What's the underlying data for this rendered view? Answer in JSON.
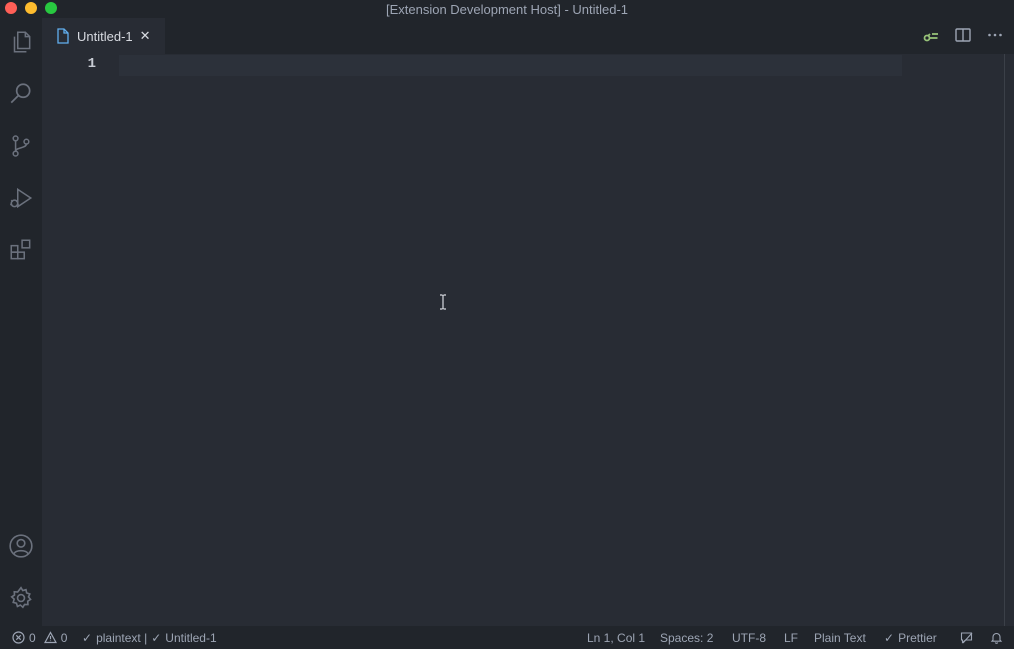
{
  "window": {
    "title": "[Extension Development Host] - Untitled-1"
  },
  "activity_bar": {
    "items": [
      {
        "name": "explorer",
        "icon": "files-icon"
      },
      {
        "name": "search",
        "icon": "search-icon"
      },
      {
        "name": "source-control",
        "icon": "source-control-icon"
      },
      {
        "name": "run-and-debug",
        "icon": "run-debug-icon"
      },
      {
        "name": "extensions",
        "icon": "extensions-icon"
      },
      {
        "name": "accounts",
        "icon": "account-icon"
      },
      {
        "name": "manage",
        "icon": "gear-icon"
      }
    ]
  },
  "tabs": [
    {
      "label": "Untitled-1",
      "icon": "file-icon",
      "active": true
    }
  ],
  "editor": {
    "line_numbers": [
      "1"
    ]
  },
  "statusbar": {
    "errors": "0",
    "warnings": "0",
    "language_check": "plaintext |",
    "file_check": "Untitled-1",
    "position": "Ln 1, Col 1",
    "indent": "Spaces: 2",
    "encoding": "UTF-8",
    "eol": "LF",
    "language": "Plain Text",
    "formatter": "Prettier"
  },
  "colors": {
    "background": "#282c34",
    "sidebar": "#21252b",
    "accent_green": "#98c379"
  }
}
